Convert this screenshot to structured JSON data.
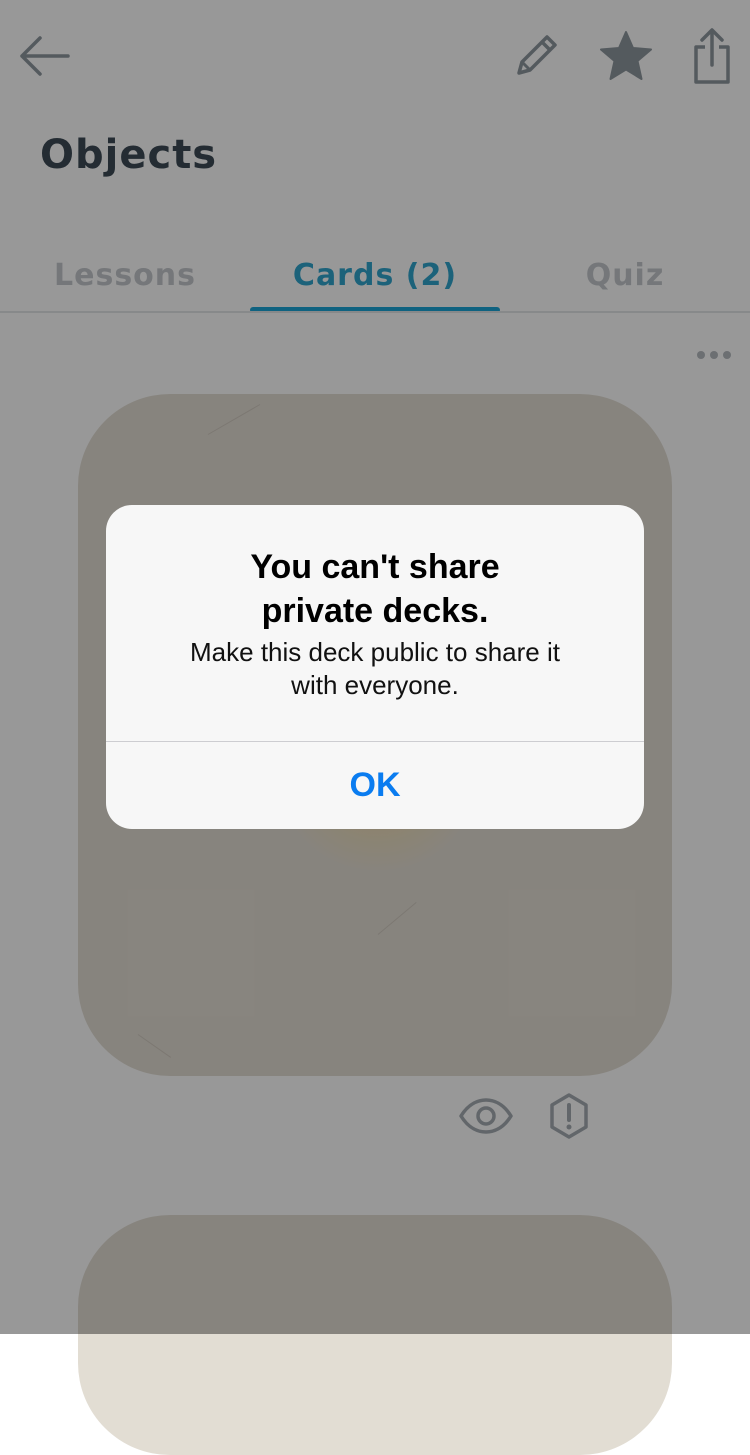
{
  "page": {
    "title": "Objects"
  },
  "toolbar": {
    "icons": [
      "back-arrow-icon",
      "pencil-icon",
      "star-icon",
      "share-icon"
    ]
  },
  "tabs": [
    {
      "label": "Lessons",
      "active": false
    },
    {
      "label": "Cards (2)",
      "active": true
    },
    {
      "label": "Quiz",
      "active": false
    }
  ],
  "card_actions": {
    "icons": [
      "eye-icon",
      "report-icon",
      "more-dots-icon"
    ]
  },
  "alert": {
    "title_line1": "You can't share",
    "title_line2": "private decks.",
    "message_line1": "Make this deck public to share it",
    "message_line2": "with everyone.",
    "button_label": "OK"
  },
  "colors": {
    "accent": "#1aa3d6",
    "alert_button": "#0a7cf0",
    "title_text": "#3c4a55",
    "inactive_tab": "#c3c7cb",
    "card_background": "#e2ddd3"
  }
}
